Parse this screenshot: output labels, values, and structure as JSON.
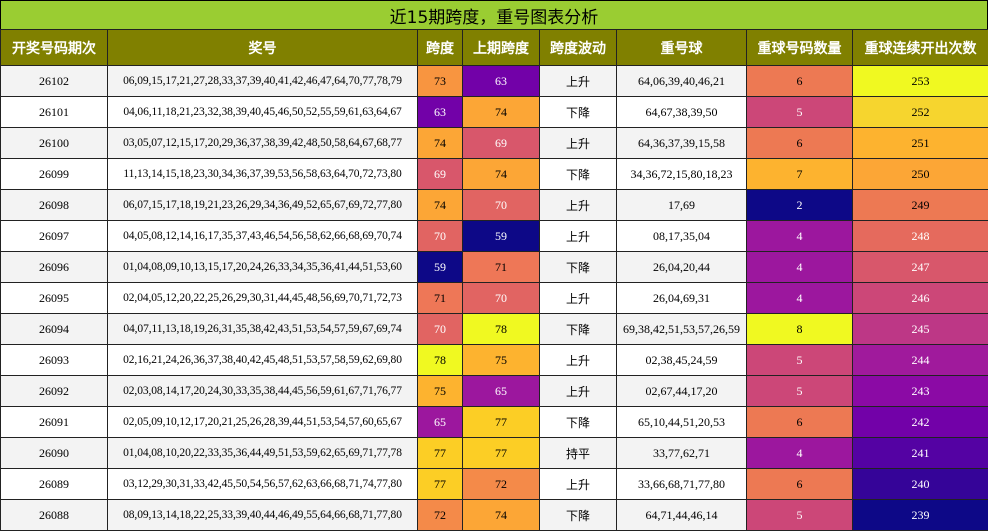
{
  "title": "近15期跨度，重号图表分析",
  "headers": [
    "开奖号码期次",
    "奖号",
    "跨度",
    "上期跨度",
    "跨度波动",
    "重号球",
    "重球号码数量",
    "重球连续开出次数"
  ],
  "rows": [
    {
      "period": "26102",
      "numbers": "06,09,15,17,21,27,28,33,37,39,40,41,42,46,47,64,70,77,78,79",
      "span": "73",
      "prev_span": "63",
      "trend": "上升",
      "repeat_balls": "64,06,39,40,46,21",
      "repeat_count": "6",
      "streak": "253"
    },
    {
      "period": "26101",
      "numbers": "04,06,11,18,21,23,32,38,39,40,45,46,50,52,55,59,61,63,64,67",
      "span": "63",
      "prev_span": "74",
      "trend": "下降",
      "repeat_balls": "64,67,38,39,50",
      "repeat_count": "5",
      "streak": "252"
    },
    {
      "period": "26100",
      "numbers": "03,05,07,12,15,17,20,29,36,37,38,39,42,48,50,58,64,67,68,77",
      "span": "74",
      "prev_span": "69",
      "trend": "上升",
      "repeat_balls": "64,36,37,39,15,58",
      "repeat_count": "6",
      "streak": "251"
    },
    {
      "period": "26099",
      "numbers": "11,13,14,15,18,23,30,34,36,37,39,53,56,58,63,64,70,72,73,80",
      "span": "69",
      "prev_span": "74",
      "trend": "下降",
      "repeat_balls": "34,36,72,15,80,18,23",
      "repeat_count": "7",
      "streak": "250"
    },
    {
      "period": "26098",
      "numbers": "06,07,15,17,18,19,21,23,26,29,34,36,49,52,65,67,69,72,77,80",
      "span": "74",
      "prev_span": "70",
      "trend": "上升",
      "repeat_balls": "17,69",
      "repeat_count": "2",
      "streak": "249"
    },
    {
      "period": "26097",
      "numbers": "04,05,08,12,14,16,17,35,37,43,46,54,56,58,62,66,68,69,70,74",
      "span": "70",
      "prev_span": "59",
      "trend": "上升",
      "repeat_balls": "08,17,35,04",
      "repeat_count": "4",
      "streak": "248"
    },
    {
      "period": "26096",
      "numbers": "01,04,08,09,10,13,15,17,20,24,26,33,34,35,36,41,44,51,53,60",
      "span": "59",
      "prev_span": "71",
      "trend": "下降",
      "repeat_balls": "26,04,20,44",
      "repeat_count": "4",
      "streak": "247"
    },
    {
      "period": "26095",
      "numbers": "02,04,05,12,20,22,25,26,29,30,31,44,45,48,56,69,70,71,72,73",
      "span": "71",
      "prev_span": "70",
      "trend": "上升",
      "repeat_balls": "26,04,69,31",
      "repeat_count": "4",
      "streak": "246"
    },
    {
      "period": "26094",
      "numbers": "04,07,11,13,18,19,26,31,35,38,42,43,51,53,54,57,59,67,69,74",
      "span": "70",
      "prev_span": "78",
      "trend": "下降",
      "repeat_balls": "69,38,42,51,53,57,26,59",
      "repeat_count": "8",
      "streak": "245"
    },
    {
      "period": "26093",
      "numbers": "02,16,21,24,26,36,37,38,40,42,45,48,51,53,57,58,59,62,69,80",
      "span": "78",
      "prev_span": "75",
      "trend": "上升",
      "repeat_balls": "02,38,45,24,59",
      "repeat_count": "5",
      "streak": "244"
    },
    {
      "period": "26092",
      "numbers": "02,03,08,14,17,20,24,30,33,35,38,44,45,56,59,61,67,71,76,77",
      "span": "75",
      "prev_span": "65",
      "trend": "上升",
      "repeat_balls": "02,67,44,17,20",
      "repeat_count": "5",
      "streak": "243"
    },
    {
      "period": "26091",
      "numbers": "02,05,09,10,12,17,20,21,25,26,28,39,44,51,53,54,57,60,65,67",
      "span": "65",
      "prev_span": "77",
      "trend": "下降",
      "repeat_balls": "65,10,44,51,20,53",
      "repeat_count": "6",
      "streak": "242"
    },
    {
      "period": "26090",
      "numbers": "01,04,08,10,20,22,33,35,36,44,49,51,53,59,62,65,69,71,77,78",
      "span": "77",
      "prev_span": "77",
      "trend": "持平",
      "repeat_balls": "33,77,62,71",
      "repeat_count": "4",
      "streak": "241"
    },
    {
      "period": "26089",
      "numbers": "03,12,29,30,31,33,42,45,50,54,56,57,62,63,66,68,71,74,77,80",
      "span": "77",
      "prev_span": "72",
      "trend": "上升",
      "repeat_balls": "33,66,68,71,77,80",
      "repeat_count": "6",
      "streak": "240"
    },
    {
      "period": "26088",
      "numbers": "08,09,13,14,18,22,25,33,39,40,44,46,49,55,64,66,68,71,77,80",
      "span": "72",
      "prev_span": "74",
      "trend": "下降",
      "repeat_balls": "64,71,44,46,14",
      "repeat_count": "5",
      "streak": "239"
    }
  ],
  "colors": {
    "title_bg": "#9ACD32",
    "header_bg": "#808000",
    "header_text": "#ffffff",
    "span_colors": {
      "59": "#0D0887",
      "63": "#7201A8",
      "65": "#9C179E",
      "69": "#D8576B",
      "70": "#E16462",
      "71": "#EE7757",
      "72": "#F48A49",
      "73": "#F89540",
      "74": "#FCA636",
      "75": "#FDB32F",
      "77": "#FCCE25",
      "78": "#F0F921"
    },
    "count_colors": {
      "2": "#0D0887",
      "4": "#9C179E",
      "5": "#CC4778",
      "6": "#ED7953",
      "7": "#FDB32F",
      "8": "#F0F921"
    },
    "streak_colors": {
      "239": "#0D0887",
      "240": "#350498",
      "241": "#5402A3",
      "242": "#7201A8",
      "243": "#8B0AA5",
      "244": "#A01A9C",
      "245": "#BD3786",
      "246": "#CC4778",
      "247": "#D8576B",
      "248": "#E56A5D",
      "249": "#ED7953",
      "250": "#FCA636",
      "251": "#FDB32F",
      "252": "#F6D52E",
      "253": "#F0F921"
    }
  }
}
